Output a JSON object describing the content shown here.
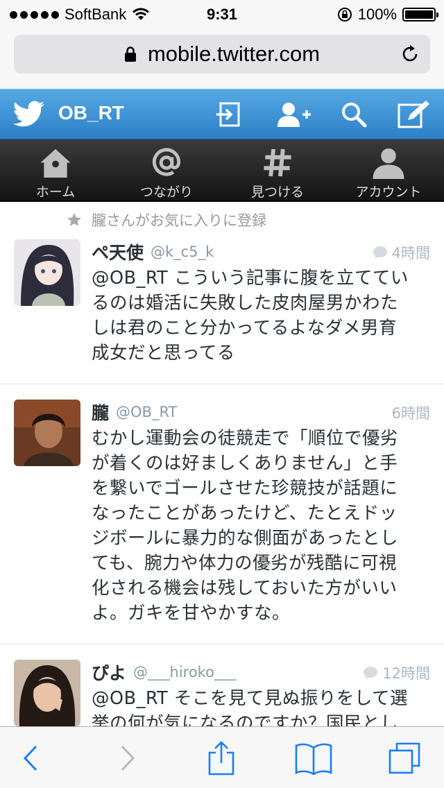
{
  "status_bar": {
    "carrier": "SoftBank",
    "time": "9:31",
    "battery": "100%",
    "battery_level": 1.0
  },
  "browser": {
    "url": "mobile.twitter.com"
  },
  "header": {
    "username": "OB_RT",
    "icons": [
      "twitter-bird-icon",
      "sign-out-icon",
      "add-user-icon",
      "search-icon",
      "compose-icon"
    ],
    "brand_color": "#3a94d8"
  },
  "nav": {
    "items": [
      {
        "label": "ホーム",
        "icon": "home-icon"
      },
      {
        "label": "つながり",
        "icon": "at-icon"
      },
      {
        "label": "見つける",
        "icon": "hashtag-icon"
      },
      {
        "label": "アカウント",
        "icon": "account-icon"
      }
    ]
  },
  "timeline": {
    "fav_notice": "朧さんがお気に入りに登録",
    "tweets": [
      {
        "name": "ペ天使",
        "handle": "@k_c5_k",
        "time": "4時間",
        "text": "@OB_RT こういう記事に腹を立ててい\nるのは婚活に失敗した皮肉屋男かわた\nしは君のこと分かってるよなダメ男育\n成女だと思ってる"
      },
      {
        "name": "朧",
        "handle": "@OB_RT",
        "time": "6時間",
        "text": "むかし運動会の徒競走で「順位で優劣\nが着くのは好ましくありません」と手\nを繋いでゴールさせた珍競技が話題に\nなったことがあったけど、たとえドッ\nジボールに暴力的な側面があったとし\nても、腕力や体力の優劣が残酷に可視\n化される機会は残しておいた方がいい\nよ。ガキを甘やかすな。"
      },
      {
        "name": "ぴよ",
        "handle": "@___hiroko___",
        "time": "12時間",
        "text": "@OB_RT そこを見て見ぬ振りをして選\n挙の何が気になるのですか？国民とし\nての承認とかのお話ならばお口を挟ん"
      }
    ]
  },
  "toolbar": {
    "icons": [
      "back-icon",
      "forward-icon",
      "share-icon",
      "bookmarks-icon",
      "tabs-icon"
    ],
    "accent": "#1a7ef5"
  }
}
